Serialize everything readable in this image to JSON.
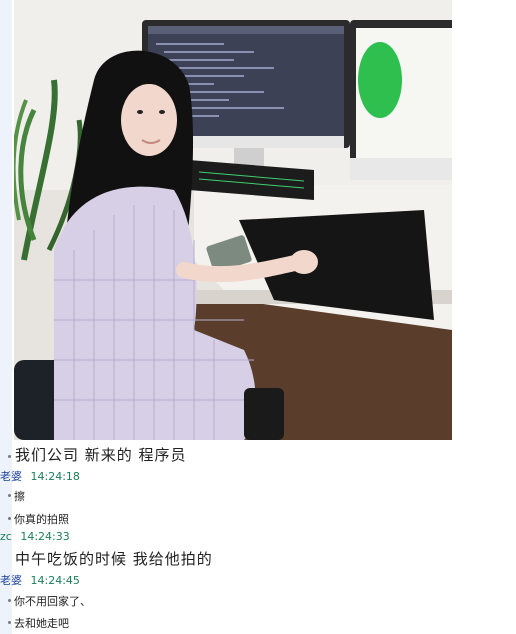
{
  "messages": {
    "m1": "我们公司  新来的  程序员",
    "s1_name": "老婆",
    "s1_time": "14:24:18",
    "m2": "擦",
    "m3": "你真的拍照",
    "s2_name": "zc",
    "s2_time": "14:24:33",
    "m4": "中午吃饭的时候  我给他拍的",
    "s3_name": "老婆",
    "s3_time": "14:24:45",
    "m5": "你不用回家了、",
    "m6": "去和她走吧"
  },
  "colors": {
    "sender_name": "#1a3f9a",
    "timestamp": "#1a7f55"
  }
}
